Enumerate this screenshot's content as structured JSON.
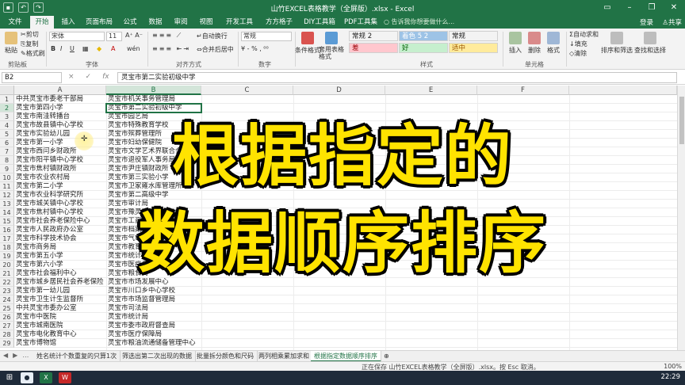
{
  "window": {
    "title": "山竹EXCEL表格教学（全屏版）.xlsx - Excel",
    "controls": [
      "minimize-icon",
      "restore-icon",
      "close-icon"
    ]
  },
  "ribbon_tabs": [
    "文件",
    "开始",
    "插入",
    "页面布局",
    "公式",
    "数据",
    "审阅",
    "视图",
    "开发工具",
    "方方格子",
    "DIY工具箱",
    "PDF工具集"
  ],
  "active_tab": "开始",
  "tell_me": "告诉我你想要做什么...",
  "account": {
    "login": "登录",
    "share": "共享"
  },
  "ribbon": {
    "clipboard": {
      "paste": "粘贴",
      "cut": "剪切",
      "copy": "复制",
      "format_painter": "格式刷",
      "label": "剪贴板"
    },
    "font": {
      "name": "宋体",
      "size": "11",
      "bold": "B",
      "italic": "I",
      "underline": "U",
      "label": "字体"
    },
    "alignment": {
      "wrap": "自动换行",
      "merge": "合并后居中",
      "label": "对齐方式"
    },
    "number": {
      "format": "常规",
      "label": "数字"
    },
    "styles": {
      "conditional": "条件格式",
      "table": "套用表格格式",
      "cells": [
        {
          "text": "常规 2",
          "bg": "#ffffff",
          "fg": "#222222"
        },
        {
          "text": "着色 5 2",
          "bg": "#9dc3e6",
          "fg": "#ffffff"
        },
        {
          "text": "常规",
          "bg": "#ffffff",
          "fg": "#222222"
        },
        {
          "text": "差",
          "bg": "#ffc7ce",
          "fg": "#9c0006"
        },
        {
          "text": "好",
          "bg": "#c6efce",
          "fg": "#006100"
        },
        {
          "text": "适中",
          "bg": "#ffeb9c",
          "fg": "#9c5700"
        }
      ],
      "label": "样式"
    },
    "cells": {
      "insert": "插入",
      "delete": "删除",
      "format": "格式",
      "label": "单元格"
    },
    "editing": {
      "autosum": "自动求和",
      "fill": "填充",
      "clear": "清除",
      "sort": "排序和筛选",
      "find": "查找和选择"
    }
  },
  "formula_bar": {
    "name_box": "B2",
    "cancel": "×",
    "enter": "✓",
    "fx": "fx",
    "content": "灵宝市第二实验初级中学"
  },
  "columns": [
    "A",
    "B",
    "C",
    "D",
    "E",
    "F"
  ],
  "rows": [
    {
      "n": "1",
      "a": "中共灵宝市委老干部局",
      "b": "灵宝市机关事务管理局"
    },
    {
      "n": "2",
      "a": "灵宝市第四小学",
      "b": "灵宝市第二实验初级中学"
    },
    {
      "n": "3",
      "a": "灵宝市南洼转播台",
      "b": "灵宝市园艺局"
    },
    {
      "n": "4",
      "a": "灵宝市故县镇中心学校",
      "b": "灵宝市特殊教育学校"
    },
    {
      "n": "5",
      "a": "灵宝市实验幼儿园",
      "b": "灵宝市殡葬管理所"
    },
    {
      "n": "6",
      "a": "灵宝市第一小学",
      "b": "灵宝市妇幼保健院"
    },
    {
      "n": "7",
      "a": "灵宝市西闫乡财政所",
      "b": "灵宝市文学艺术界联合会"
    },
    {
      "n": "8",
      "a": "灵宝市阳平镇中心学校",
      "b": "灵宝市退役军人事务局"
    },
    {
      "n": "9",
      "a": "灵宝市焦村镇财政所",
      "b": "灵宝市尹庄镇财政所"
    },
    {
      "n": "10",
      "a": "灵宝市农业农村局",
      "b": "灵宝市第三实验小学"
    },
    {
      "n": "11",
      "a": "灵宝市第二小学",
      "b": "灵宝市卫家雍水库管理所"
    },
    {
      "n": "12",
      "a": "灵宝市农业科学研究所",
      "b": "灵宝市第二高级中学"
    },
    {
      "n": "13",
      "a": "灵宝市城关镇中心学校",
      "b": "灵宝市审计局"
    },
    {
      "n": "14",
      "a": "灵宝市焦村镇中心学校",
      "b": "灵宝市豫灵镇中心学校"
    },
    {
      "n": "15",
      "a": "灵宝市社会养老保险中心",
      "b": "灵宝市工商业联合会"
    },
    {
      "n": "16",
      "a": "灵宝市人民政府办公室",
      "b": "灵宝市档案馆"
    },
    {
      "n": "17",
      "a": "灵宝市科学技术协会",
      "b": "灵宝市气象局"
    },
    {
      "n": "18",
      "a": "灵宝市商务局",
      "b": "灵宝市教育局"
    },
    {
      "n": "19",
      "a": "灵宝市第五小学",
      "b": "灵宝市统计局"
    },
    {
      "n": "20",
      "a": "灵宝市第六小学",
      "b": "灵宝市医疗保障局"
    },
    {
      "n": "21",
      "a": "灵宝市社会福利中心",
      "b": "灵宝市粮食局"
    },
    {
      "n": "22",
      "a": "灵宝市城乡居民社会养老保险",
      "b": "灵宝市市场发展中心"
    },
    {
      "n": "23",
      "a": "灵宝市第一幼儿园",
      "b": "灵宝市川口乡中心学校"
    },
    {
      "n": "24",
      "a": "灵宝市卫生计生监督所",
      "b": "灵宝市市场监督管理局"
    },
    {
      "n": "25",
      "a": "中共灵宝市委办公室",
      "b": "灵宝市司法局"
    },
    {
      "n": "26",
      "a": "灵宝市中医院",
      "b": "灵宝市统计局"
    },
    {
      "n": "27",
      "a": "灵宝市城南医院",
      "b": "灵宝市委市政府督查局"
    },
    {
      "n": "28",
      "a": "灵宝市电化教育中心",
      "b": "灵宝市医疗保障局"
    },
    {
      "n": "29",
      "a": "灵宝市博物馆",
      "b": "灵宝市粮油流通储备管理中心"
    }
  ],
  "overlay": {
    "line1": "根据指定的",
    "line2": "数据顺序排序"
  },
  "sheet_tabs": [
    "姓名统计个数重复的只算1次",
    "筛选出第二次出现的数据",
    "批量拆分颜色和尺码",
    "两列相乘累加求和",
    "根据指定数据顺序排序"
  ],
  "active_sheet": "根据指定数据顺序排序",
  "status": {
    "text": "正在保存 山竹EXCEL表格教学（全屏版）.xlsx。按 Esc 取消。",
    "zoom": "100%"
  },
  "taskbar": {
    "clock": "22:29"
  },
  "colors": {
    "excel_green": "#217346",
    "overlay_yellow": "#ffe300"
  }
}
